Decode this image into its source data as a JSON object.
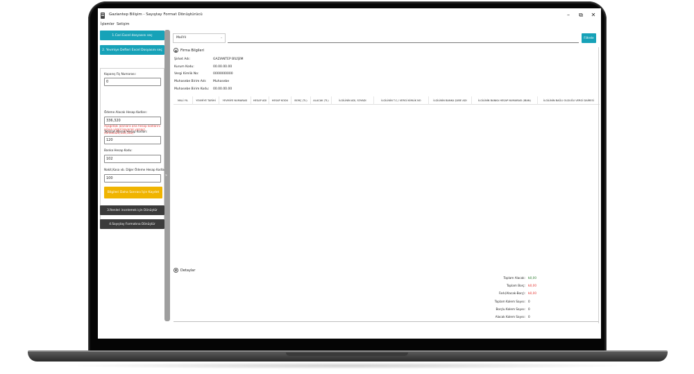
{
  "window": {
    "title": "Gaziantep Bilişim - Sayıştay Format Dönüştürücü",
    "controls": [
      "–",
      "⧉",
      "✕"
    ]
  },
  "menu": [
    "İşlemler",
    "Setişim"
  ],
  "left_panel": {
    "btn_choose_excel": "1.Cari Excel dosyasını seç",
    "btn_choose_ledger": "2. Yevmiye Defteri Excel Dosyasını seç",
    "closing_label": "Kapanış Fiş Numarası:",
    "closing_value": "0",
    "warning": "Aşağıdaki alanlara ana hesap kodlarını araya virgül koyarak yazınız.(Örnek320,120,102)",
    "payment_label": "Ödeme Alacak Hesap Kodları:",
    "payment_value": "336,320",
    "collection_label": "Tahsilat Alacak Hesap Kodları:",
    "collection_value": "120",
    "bank_label": "Banka Hesap Kodu:",
    "bank_value": "102",
    "cash_label": "Nakit,Kasa vb. Diğer Ödeme Hesap Kodları:",
    "cash_value": "100",
    "btn_save": "Bilgileri Daha Sonrası İçin Kaydet",
    "btn_review": "3.İtenleri incelemek için Dönüştür",
    "btn_convert": "4.Sayıştay Formatına Dönüştür"
  },
  "toolbar": {
    "combo_value": "MaliYıl",
    "filter_label": "Filtrele"
  },
  "firma": {
    "header": "Firma Bilgileri",
    "rows": [
      {
        "k": "Şirket Adı:",
        "v": "GAZIANTEP BİLİŞİM"
      },
      {
        "k": "Kurum Kodu:",
        "v": "00.00.00.00"
      },
      {
        "k": "Vergi Kimlik No:",
        "v": "0000000000"
      },
      {
        "k": "Muhasebe Birim Adı:",
        "v": "Muhasebe"
      },
      {
        "k": "Muhasebe Birim Kodu:",
        "v": "00.00.00.00"
      }
    ]
  },
  "grid": {
    "columns": [
      "MALİ YIL",
      "YEVMİYE TARİHİ",
      "YEVMİYE NUMARASI",
      "HESAP ADI",
      "HESAP KODU",
      "BORÇ (TL)",
      "ALACAK (TL)",
      "İLGİLİNİN ADI, SOYADI",
      "İLGİLİNİN T.C./ VERGİ KİMLİK NO",
      "İLGİLİNİN BANKA ŞUBE ADI",
      "İLGİLİNİN BANKA HESAP NUMARASI (IBAN)",
      "İLGİLİNİN BAĞLI OLDUĞU VERGİ DAİRESİ"
    ]
  },
  "detaylar": {
    "header": "Detaylar",
    "rows": [
      {
        "k": "Toplam Alacak:",
        "v": "₺0,00"
      },
      {
        "k": "Toplam Borç:",
        "v": "₺0,00"
      },
      {
        "k": "Fark(Alacak-Borç):",
        "v": "₺0,00"
      },
      {
        "k": "Toplam Kalem Sayısı:",
        "v": "0"
      },
      {
        "k": "Borçlu Kalem Sayısı:",
        "v": "0"
      },
      {
        "k": "Alacak Kalem Sayısı:",
        "v": "0"
      }
    ]
  },
  "colors": {
    "teal": "#17a2b8",
    "yellow": "#f0b400",
    "dark": "#3b3b3b",
    "green": "#2e7d32",
    "red": "#e53935"
  }
}
